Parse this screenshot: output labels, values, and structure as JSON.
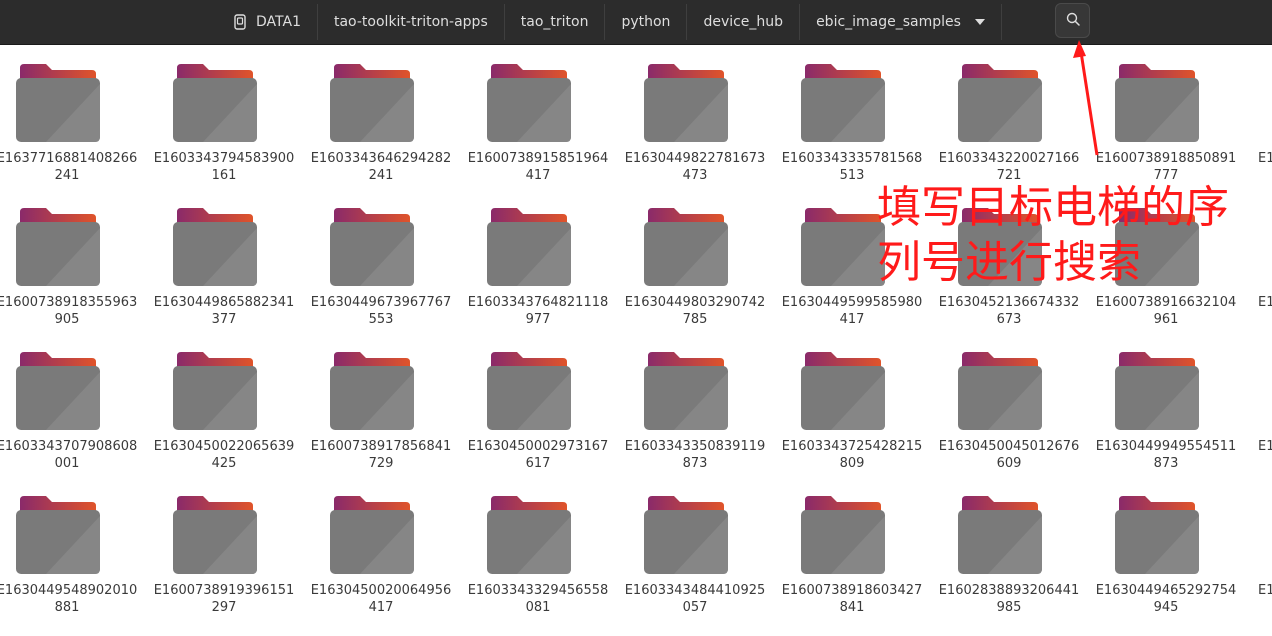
{
  "breadcrumbs": [
    {
      "label": "DATA1",
      "icon": "drive-icon"
    },
    {
      "label": "tao-toolkit-triton-apps"
    },
    {
      "label": "tao_triton"
    },
    {
      "label": "python"
    },
    {
      "label": "device_hub"
    },
    {
      "label": "ebic_image_samples",
      "icon": "chevron-down-icon"
    }
  ],
  "search_button": {
    "icon": "search-icon"
  },
  "folders": [
    {
      "line1": "E1637716881408266",
      "line2": "241"
    },
    {
      "line1": "E1603343794583900",
      "line2": "161"
    },
    {
      "line1": "E1603343646294282",
      "line2": "241"
    },
    {
      "line1": "E1600738915851964",
      "line2": "417"
    },
    {
      "line1": "E1630449822781673",
      "line2": "473"
    },
    {
      "line1": "E1603343335781568",
      "line2": "513"
    },
    {
      "line1": "E1603343220027166",
      "line2": "721"
    },
    {
      "line1": "E1600738918850891",
      "line2": "777"
    },
    {
      "line1": "E1600738918355963",
      "line2": "905"
    },
    {
      "line1": "E1630449865882341",
      "line2": "377"
    },
    {
      "line1": "E1630449673967767",
      "line2": "553"
    },
    {
      "line1": "E1603343764821118",
      "line2": "977"
    },
    {
      "line1": "E1630449803290742",
      "line2": "785"
    },
    {
      "line1": "E1630449599585980",
      "line2": "417"
    },
    {
      "line1": "E1630452136674332",
      "line2": "673"
    },
    {
      "line1": "E1600738916632104",
      "line2": "961"
    },
    {
      "line1": "E1603343707908608",
      "line2": "001"
    },
    {
      "line1": "E1630450022065639",
      "line2": "425"
    },
    {
      "line1": "E1600738917856841",
      "line2": "729"
    },
    {
      "line1": "E1630450002973167",
      "line2": "617"
    },
    {
      "line1": "E1603343350839119",
      "line2": "873"
    },
    {
      "line1": "E1603343725428215",
      "line2": "809"
    },
    {
      "line1": "E1630450045012676",
      "line2": "609"
    },
    {
      "line1": "E1630449949554511",
      "line2": "873"
    },
    {
      "line1": "E1630449548902010",
      "line2": "881"
    },
    {
      "line1": "E1600738919396151",
      "line2": "297"
    },
    {
      "line1": "E1630450020064956",
      "line2": "417"
    },
    {
      "line1": "E1603343329456558",
      "line2": "081"
    },
    {
      "line1": "E1603343484410925",
      "line2": "057"
    },
    {
      "line1": "E1600738918603427",
      "line2": "841"
    },
    {
      "line1": "E1602838893206441",
      "line2": "985"
    },
    {
      "line1": "E1630449465292754",
      "line2": "945"
    }
  ],
  "partial_column_label": "E1",
  "annotation": {
    "line1": "填写目标电梯的序",
    "line2": "列号进行搜索",
    "color": "#ff1a1a"
  },
  "colors": {
    "topbar": "#2c2c2c",
    "folder_body": "#7a7a7a",
    "folder_tab_gradient": [
      "#8a2a6a",
      "#e0542a"
    ]
  }
}
